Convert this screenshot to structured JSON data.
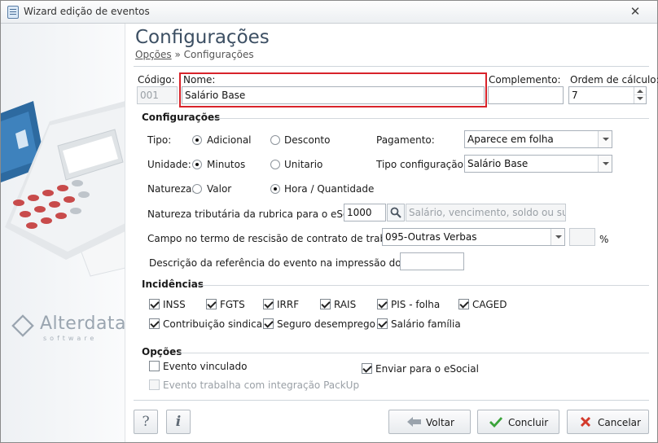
{
  "window": {
    "title": "Wizard edição de eventos",
    "close_glyph": "✕"
  },
  "sidebar": {
    "brand_name": "Alterdata",
    "brand_sub": "software"
  },
  "header": {
    "title": "Configurações",
    "breadcrumb_link": "Opções",
    "breadcrumb_separator": "»",
    "breadcrumb_current": "Configurações"
  },
  "fields": {
    "codigo": {
      "label": "Código:",
      "value": "001"
    },
    "nome": {
      "label": "Nome:",
      "value": "Salário Base"
    },
    "complemento": {
      "label": "Complemento:",
      "value": ""
    },
    "ordem": {
      "label": "Ordem de cálculo:",
      "value": "7"
    }
  },
  "config": {
    "section": "Configurações",
    "tipo": {
      "label": "Tipo:",
      "option1": "Adicional",
      "option2": "Desconto",
      "selected": "Adicional"
    },
    "unidade": {
      "label": "Unidade:",
      "option1": "Minutos",
      "option2": "Unitario",
      "selected": "Minutos"
    },
    "natureza": {
      "label": "Natureza:",
      "option1": "Valor",
      "option2": "Hora / Quantidade",
      "selected": "Hora / Quantidade"
    },
    "pagamento": {
      "label": "Pagamento:",
      "value": "Aparece em folha"
    },
    "tipo_config": {
      "label": "Tipo configuração:",
      "value": "Salário Base"
    },
    "natureza_trib": {
      "label": "Natureza tributária da rubrica para o eSocial:",
      "code": "1000",
      "desc_placeholder": "Salário, vencimento, soldo ou subsídio"
    },
    "campo_rescisao": {
      "label": "Campo no termo de rescisão de contrato de trabalho:",
      "value": "095-Outras Verbas",
      "percent_value": "",
      "percent_sign": "%"
    },
    "descricao_trct": {
      "label": "Descrição da referência do evento na impressão do TRCT:",
      "value": ""
    }
  },
  "incidencias": {
    "section": "Incidências",
    "items": [
      {
        "label": "INSS",
        "checked": true
      },
      {
        "label": "FGTS",
        "checked": true
      },
      {
        "label": "IRRF",
        "checked": true
      },
      {
        "label": "RAIS",
        "checked": true
      },
      {
        "label": "PIS - folha",
        "checked": true
      },
      {
        "label": "CAGED",
        "checked": true
      },
      {
        "label": "Contribuição sindical",
        "checked": true
      },
      {
        "label": "Seguro desemprego",
        "checked": true
      },
      {
        "label": "Salário família",
        "checked": true
      }
    ]
  },
  "opcoes": {
    "section": "Opções",
    "evento_vinculado": {
      "label": "Evento vinculado",
      "checked": false
    },
    "packup": {
      "label": "Evento trabalha com integração PackUp",
      "checked": false,
      "disabled": true
    },
    "esocial": {
      "label": "Enviar para o eSocial",
      "checked": true
    }
  },
  "footer": {
    "help_glyph": "?",
    "info_glyph": "i",
    "back_label": "Voltar",
    "finish_label": "Concluir",
    "cancel_label": "Cancelar"
  },
  "colors": {
    "highlight": "#d8232a",
    "heading": "#3c4f63",
    "finish_check": "#3aa33a",
    "cancel_x": "#d33a2c"
  }
}
